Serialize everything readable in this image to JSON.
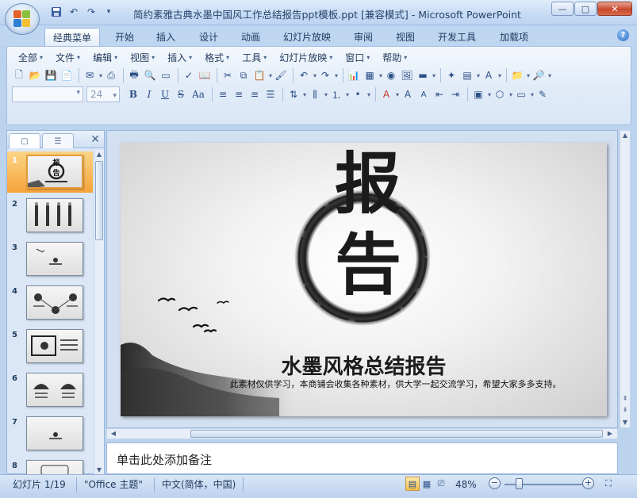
{
  "app": {
    "title": "简约素雅古典水墨中国风工作总结报告ppt模板.ppt [兼容模式] - Microsoft PowerPoint"
  },
  "window_controls": {
    "minimize": "—",
    "maximize": "□",
    "close": "✕"
  },
  "quick_access": {
    "icons": [
      "save-icon",
      "undo-icon",
      "redo-icon",
      "customize-icon"
    ]
  },
  "tabs": [
    {
      "label": "经典菜单",
      "active": true
    },
    {
      "label": "开始"
    },
    {
      "label": "插入"
    },
    {
      "label": "设计"
    },
    {
      "label": "动画"
    },
    {
      "label": "幻灯片放映"
    },
    {
      "label": "审阅"
    },
    {
      "label": "视图"
    },
    {
      "label": "开发工具"
    },
    {
      "label": "加载项"
    }
  ],
  "menu": [
    {
      "label": "全部"
    },
    {
      "label": "文件"
    },
    {
      "label": "编辑"
    },
    {
      "label": "视图"
    },
    {
      "label": "插入"
    },
    {
      "label": "格式"
    },
    {
      "label": "工具"
    },
    {
      "label": "幻灯片放映"
    },
    {
      "label": "窗口"
    },
    {
      "label": "帮助"
    }
  ],
  "format": {
    "font_name": "",
    "font_size": "24",
    "bold": "B",
    "italic": "I",
    "underline": "U",
    "strike": "S",
    "shadow": "Aa"
  },
  "slides_panel": {
    "slide_numbers": [
      "1",
      "2",
      "3",
      "4",
      "5",
      "6",
      "7",
      "8"
    ],
    "selected": 1
  },
  "slide": {
    "big_char_1": "报",
    "big_char_2": "告",
    "title": "水墨风格总结报告",
    "subtitle": "此素材仅供学习，本商铺会收集各种素材，供大学一起交流学习，希望大家多多支持。"
  },
  "notes": {
    "placeholder": "单击此处添加备注"
  },
  "status": {
    "slide_info": "幻灯片 1/19",
    "theme": "\"Office 主题\"",
    "language": "中文(简体，中国)",
    "zoom": "48%",
    "zoom_level": 0.48
  },
  "colors": {
    "accent": "#f6a339",
    "ribbon_bg": "#dbe7f6",
    "ink": "#1b1b1b"
  }
}
